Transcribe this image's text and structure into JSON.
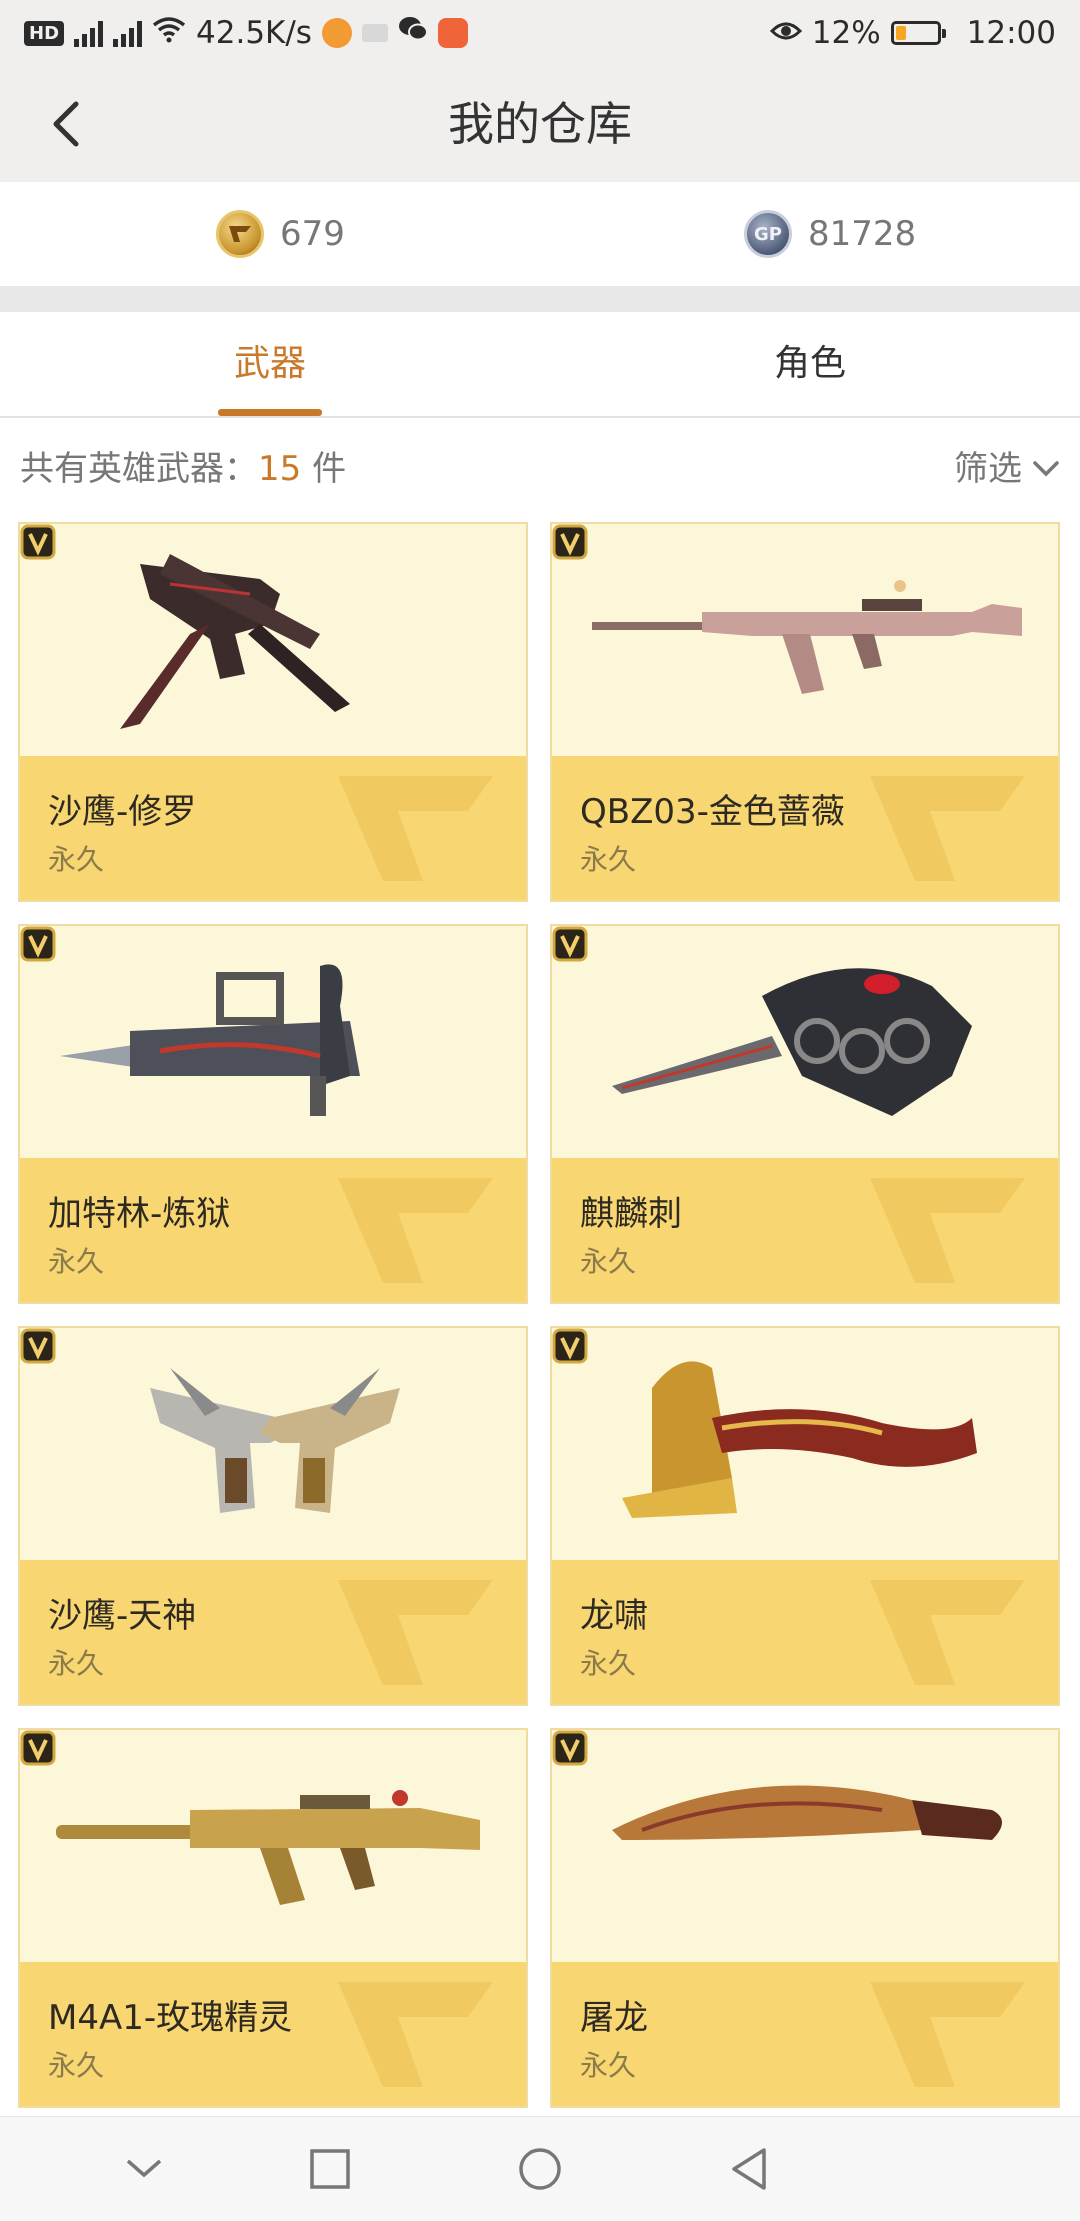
{
  "status_bar": {
    "hd": "HD",
    "net1": "4G",
    "net2": "3G",
    "speed": "42.5K/s",
    "battery_pct": "12%",
    "battery_level": 0.12,
    "time": "12:00"
  },
  "header": {
    "title": "我的仓库"
  },
  "currency": {
    "cf_coin_label": "",
    "cf_value": "679",
    "gp_icon_text": "GP",
    "gp_value": "81728"
  },
  "tabs": [
    {
      "label": "武器",
      "active": true
    },
    {
      "label": "角色",
      "active": false
    }
  ],
  "summary": {
    "prefix": "共有英雄武器：",
    "count": "15",
    "suffix": " 件",
    "filter_label": "筛选"
  },
  "items": [
    {
      "name": "沙鹰-修罗",
      "duration": "永久",
      "icon": "dual-pistol-blade-icon"
    },
    {
      "name": "QBZ03-金色蔷薇",
      "duration": "永久",
      "icon": "rifle-icon"
    },
    {
      "name": "加特林-炼狱",
      "duration": "永久",
      "icon": "gatling-gun-icon"
    },
    {
      "name": "麒麟刺",
      "duration": "永久",
      "icon": "knuckle-dagger-icon"
    },
    {
      "name": "沙鹰-天神",
      "duration": "永久",
      "icon": "twin-pistols-icon"
    },
    {
      "name": "龙啸",
      "duration": "永久",
      "icon": "dragon-axe-icon"
    },
    {
      "name": "M4A1-玫瑰精灵",
      "duration": "永久",
      "icon": "assault-rifle-icon"
    },
    {
      "name": "屠龙",
      "duration": "永久",
      "icon": "machete-icon"
    }
  ],
  "colors": {
    "accent": "#c8792a",
    "card_top": "#fdf7da",
    "card_bottom": "#f8d672"
  }
}
